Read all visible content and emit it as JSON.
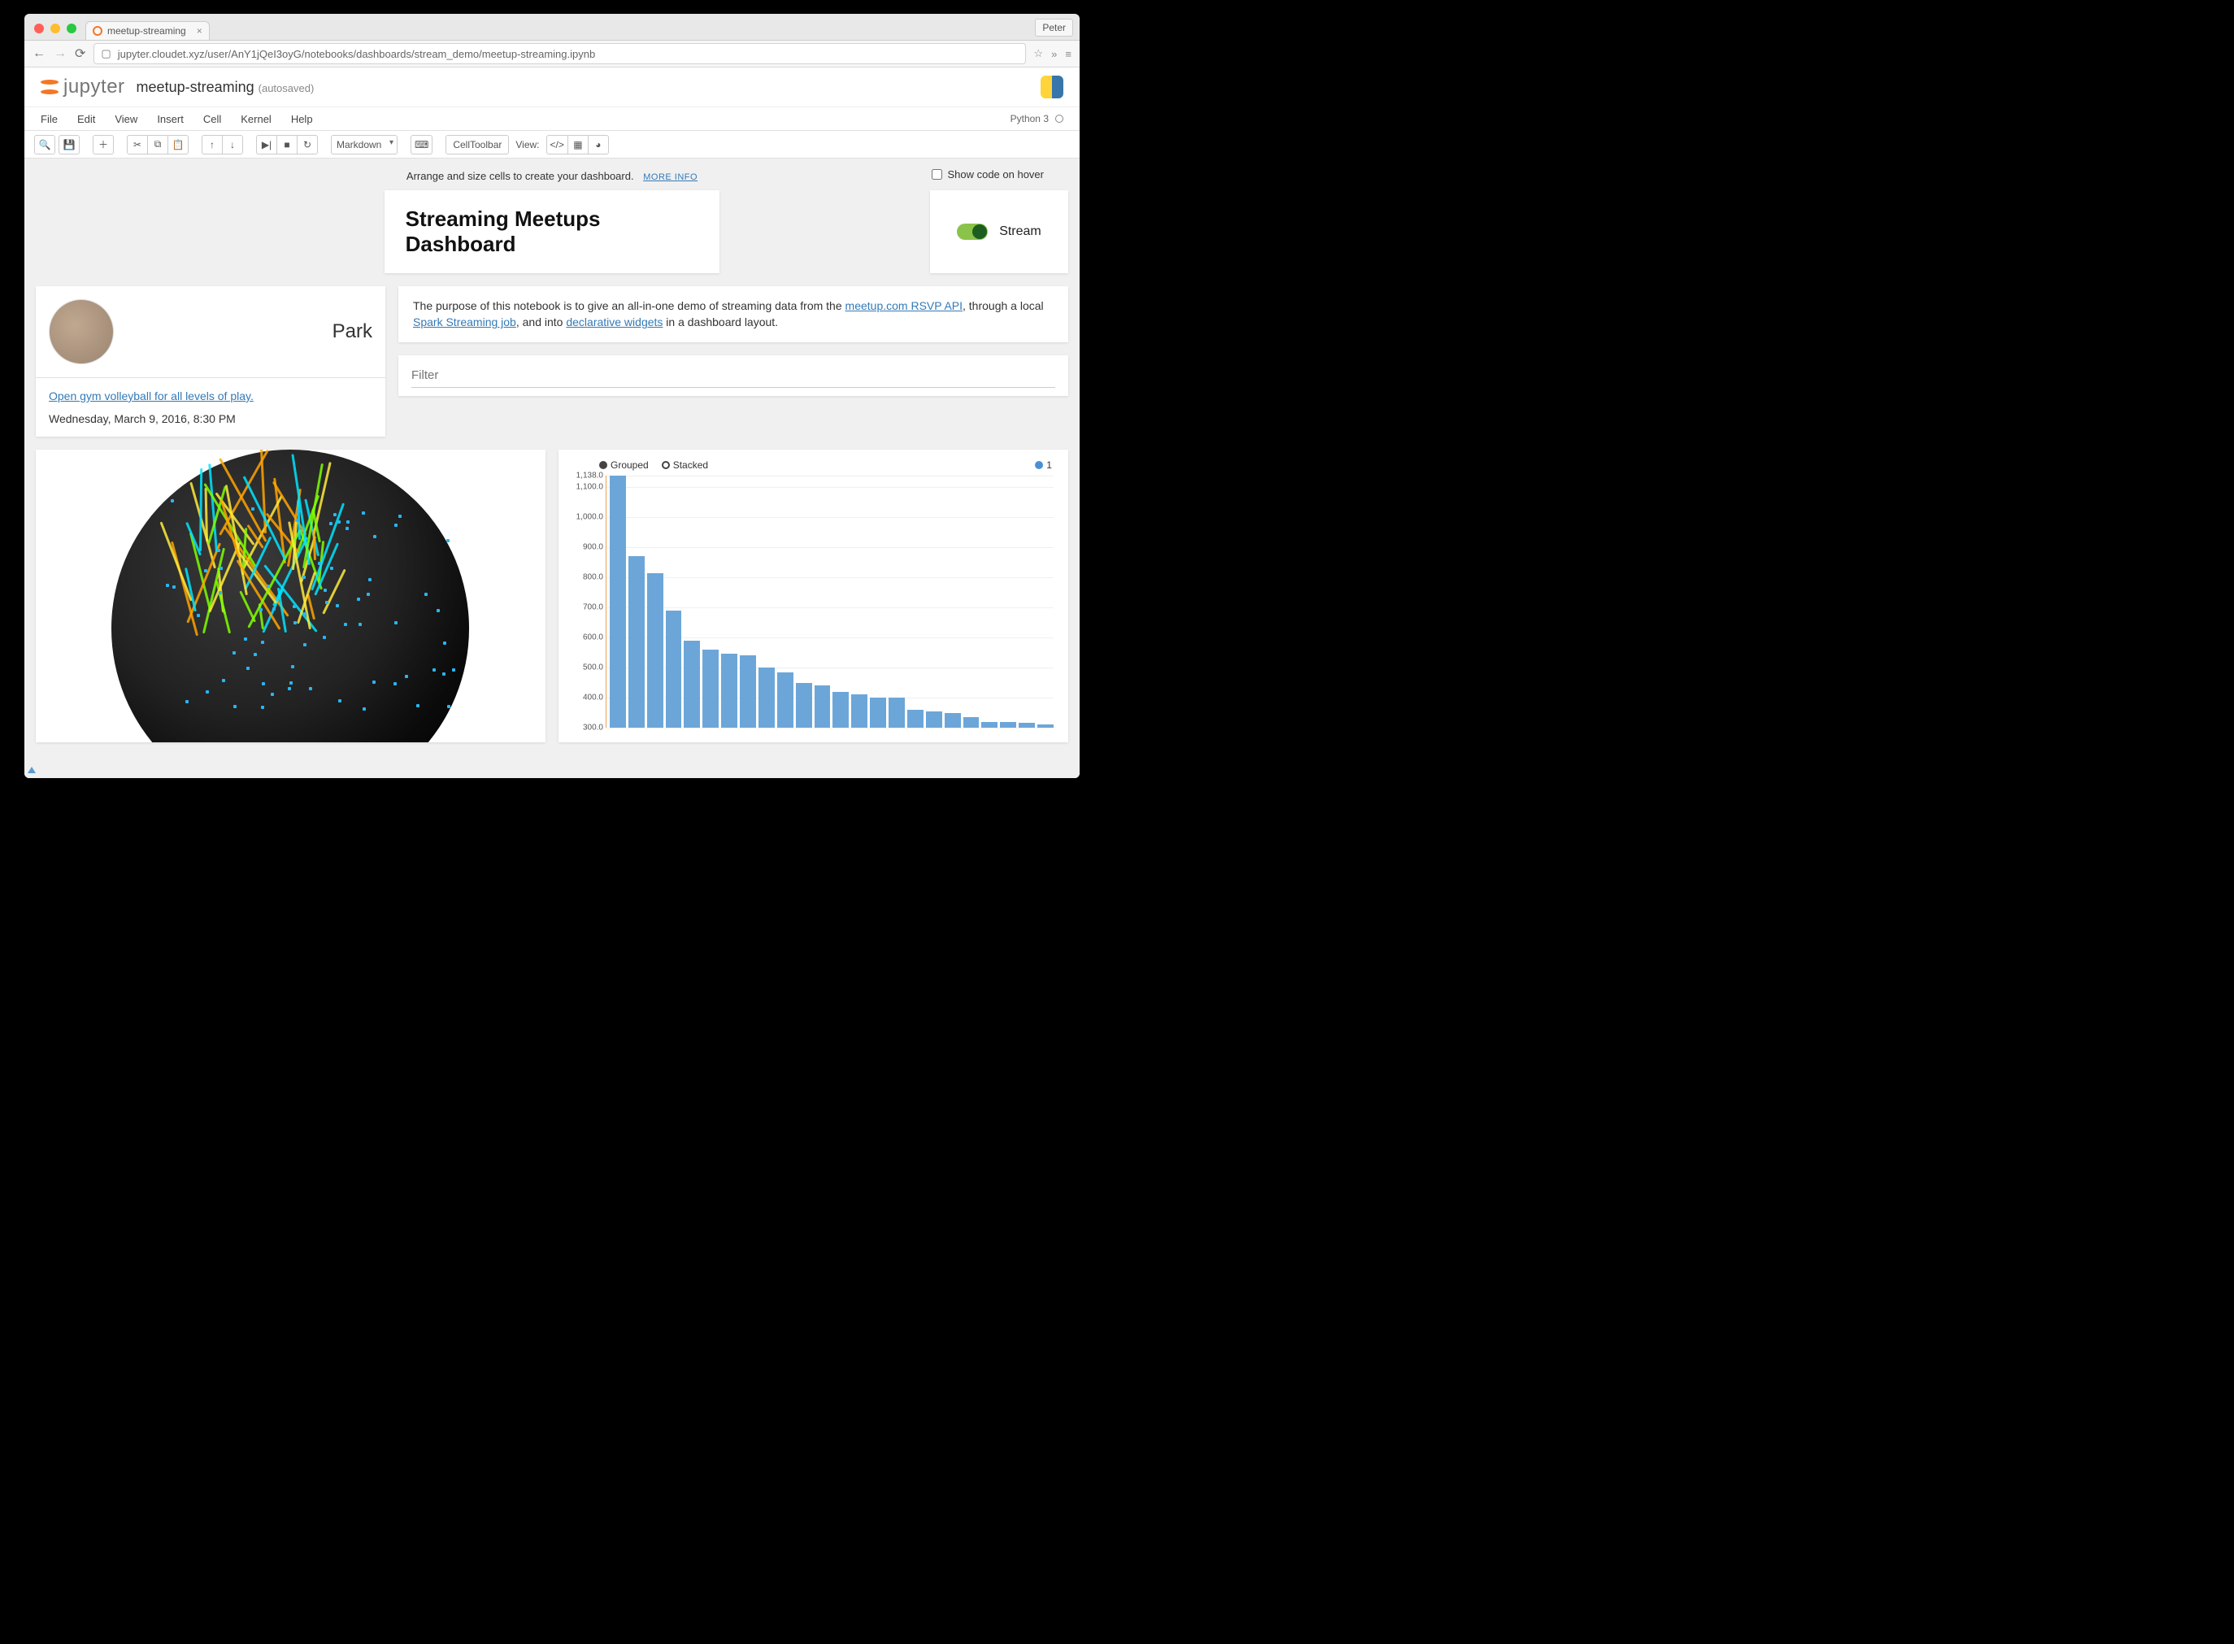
{
  "browser": {
    "tab_title": "meetup-streaming",
    "user_button": "Peter",
    "url": "jupyter.cloudet.xyz/user/AnY1jQeI3oyG/notebooks/dashboards/stream_demo/meetup-streaming.ipynb"
  },
  "header": {
    "app_name": "jupyter",
    "notebook_name": "meetup-streaming",
    "save_status": "(autosaved)"
  },
  "menu": [
    "File",
    "Edit",
    "View",
    "Insert",
    "Cell",
    "Kernel",
    "Help"
  ],
  "kernel": {
    "name": "Python 3"
  },
  "toolbar": {
    "cell_type": "Markdown",
    "celltoolbar_label": "CellToolbar",
    "view_label": "View:"
  },
  "hint": {
    "text": "Arrange and size cells to create your dashboard.",
    "more": "MORE INFO",
    "hover_label": "Show code on hover"
  },
  "dashboard": {
    "title": "Streaming Meetups Dashboard",
    "stream_label": "Stream",
    "event": {
      "venue": "Park",
      "link": "Open gym volleyball for all levels of play.",
      "datetime": "Wednesday, March 9, 2016, 8:30 PM"
    },
    "description": {
      "p1a": "The purpose of this notebook is to give an all-in-one demo of streaming data from the ",
      "a1": "meetup.com RSVP API",
      "p1b": ", through a local ",
      "a2": "Spark Streaming job",
      "p1c": ", and into ",
      "a3": "declarative widgets",
      "p1d": " in a dashboard layout."
    },
    "filter_placeholder": "Filter",
    "chart": {
      "grouped": "Grouped",
      "stacked": "Stacked",
      "series_label": "1",
      "ymax_label": "1,138.0"
    }
  },
  "chart_data": {
    "type": "bar",
    "title": "",
    "xlabel": "",
    "ylabel": "",
    "ylim": [
      300,
      1138
    ],
    "y_ticks": [
      300,
      400,
      500,
      600,
      700,
      800,
      900,
      1000,
      1100,
      1138
    ],
    "y_tick_labels": [
      "300.0",
      "400.0",
      "500.0",
      "600.0",
      "700.0",
      "800.0",
      "900.0",
      "1,000.0",
      "1,100.0",
      "1,138.0"
    ],
    "series": [
      {
        "name": "1",
        "values": [
          1138,
          870,
          815,
          690,
          590,
          560,
          545,
          540,
          500,
          485,
          450,
          440,
          420,
          410,
          400,
          400,
          360,
          355,
          350,
          335,
          320,
          318,
          315,
          312
        ]
      }
    ],
    "legend_controls": [
      "Grouped",
      "Stacked"
    ],
    "color": "#6ca6d9"
  }
}
